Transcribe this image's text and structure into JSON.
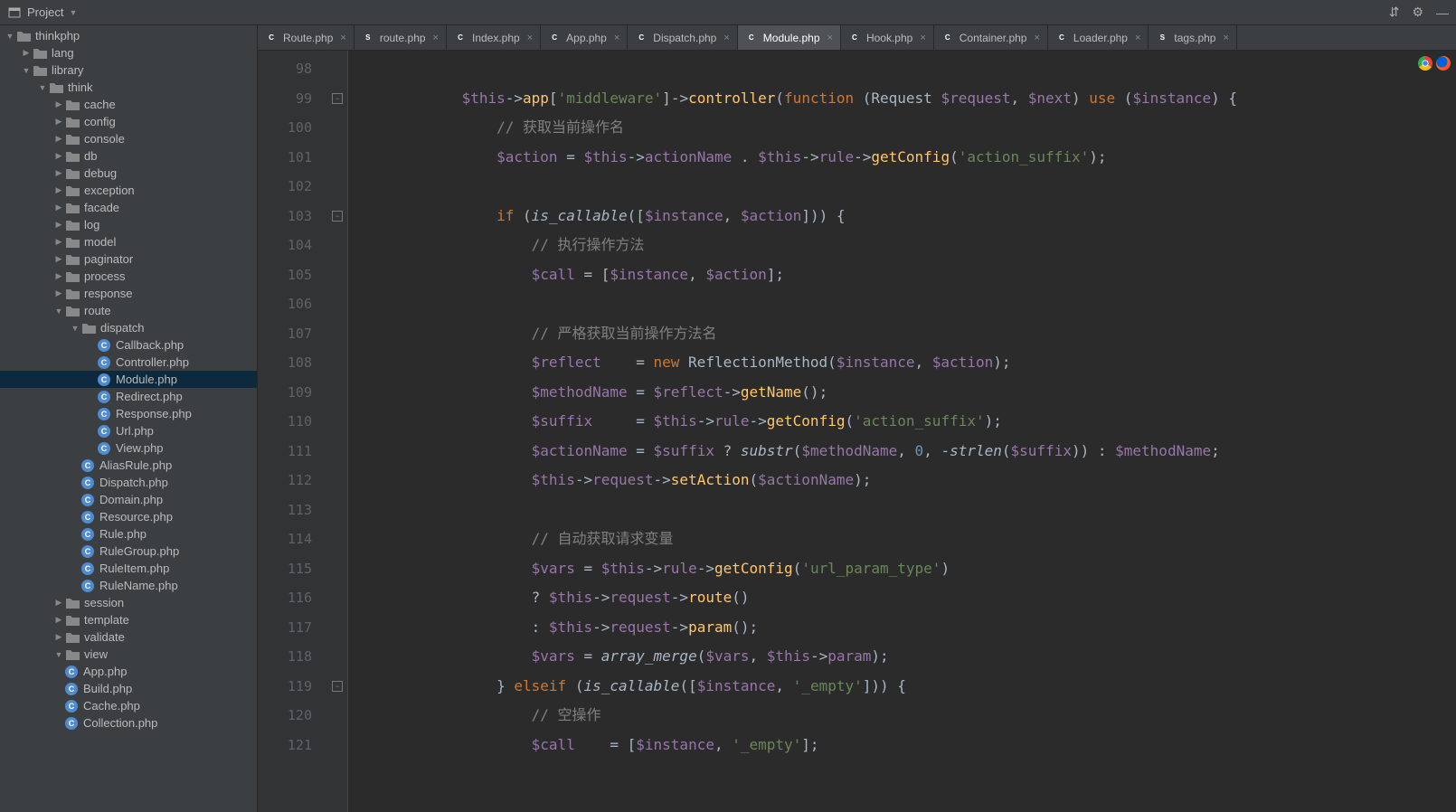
{
  "toolbar": {
    "title": "Project"
  },
  "tabs": [
    {
      "icon": "C",
      "cls": "php-c",
      "label": "Route.php"
    },
    {
      "icon": "S",
      "cls": "php-s",
      "label": "route.php"
    },
    {
      "icon": "C",
      "cls": "php-c",
      "label": "Index.php"
    },
    {
      "icon": "C",
      "cls": "php-c",
      "label": "App.php"
    },
    {
      "icon": "C",
      "cls": "php-c",
      "label": "Dispatch.php"
    },
    {
      "icon": "C",
      "cls": "php-c",
      "label": "Module.php",
      "active": true
    },
    {
      "icon": "C",
      "cls": "php-c",
      "label": "Hook.php"
    },
    {
      "icon": "C",
      "cls": "php-c",
      "label": "Container.php"
    },
    {
      "icon": "C",
      "cls": "php-c",
      "label": "Loader.php"
    },
    {
      "icon": "S",
      "cls": "php-s",
      "label": "tags.php"
    }
  ],
  "tree": [
    {
      "d": 0,
      "a": "open",
      "t": "fld",
      "l": "thinkphp"
    },
    {
      "d": 1,
      "a": "closed",
      "t": "fld",
      "l": "lang"
    },
    {
      "d": 1,
      "a": "open",
      "t": "fld",
      "l": "library"
    },
    {
      "d": 2,
      "a": "open",
      "t": "fld",
      "l": "think"
    },
    {
      "d": 3,
      "a": "closed",
      "t": "fld",
      "l": "cache"
    },
    {
      "d": 3,
      "a": "closed",
      "t": "fld",
      "l": "config"
    },
    {
      "d": 3,
      "a": "closed",
      "t": "fld",
      "l": "console"
    },
    {
      "d": 3,
      "a": "closed",
      "t": "fld",
      "l": "db"
    },
    {
      "d": 3,
      "a": "closed",
      "t": "fld",
      "l": "debug"
    },
    {
      "d": 3,
      "a": "closed",
      "t": "fld",
      "l": "exception"
    },
    {
      "d": 3,
      "a": "closed",
      "t": "fld",
      "l": "facade"
    },
    {
      "d": 3,
      "a": "closed",
      "t": "fld",
      "l": "log"
    },
    {
      "d": 3,
      "a": "closed",
      "t": "fld",
      "l": "model"
    },
    {
      "d": 3,
      "a": "closed",
      "t": "fld",
      "l": "paginator"
    },
    {
      "d": 3,
      "a": "closed",
      "t": "fld",
      "l": "process"
    },
    {
      "d": 3,
      "a": "closed",
      "t": "fld",
      "l": "response"
    },
    {
      "d": 3,
      "a": "open",
      "t": "fld",
      "l": "route"
    },
    {
      "d": 4,
      "a": "open",
      "t": "fld",
      "l": "dispatch"
    },
    {
      "d": 5,
      "a": "none",
      "t": "php-c",
      "l": "Callback.php"
    },
    {
      "d": 5,
      "a": "none",
      "t": "php-c",
      "l": "Controller.php"
    },
    {
      "d": 5,
      "a": "none",
      "t": "php-c",
      "l": "Module.php",
      "sel": true
    },
    {
      "d": 5,
      "a": "none",
      "t": "php-c",
      "l": "Redirect.php"
    },
    {
      "d": 5,
      "a": "none",
      "t": "php-c",
      "l": "Response.php"
    },
    {
      "d": 5,
      "a": "none",
      "t": "php-c",
      "l": "Url.php"
    },
    {
      "d": 5,
      "a": "none",
      "t": "php-c",
      "l": "View.php"
    },
    {
      "d": 4,
      "a": "none",
      "t": "php-c",
      "l": "AliasRule.php"
    },
    {
      "d": 4,
      "a": "none",
      "t": "php-c",
      "l": "Dispatch.php"
    },
    {
      "d": 4,
      "a": "none",
      "t": "php-c",
      "l": "Domain.php"
    },
    {
      "d": 4,
      "a": "none",
      "t": "php-c",
      "l": "Resource.php"
    },
    {
      "d": 4,
      "a": "none",
      "t": "php-c",
      "l": "Rule.php"
    },
    {
      "d": 4,
      "a": "none",
      "t": "php-c",
      "l": "RuleGroup.php"
    },
    {
      "d": 4,
      "a": "none",
      "t": "php-c",
      "l": "RuleItem.php"
    },
    {
      "d": 4,
      "a": "none",
      "t": "php-c",
      "l": "RuleName.php"
    },
    {
      "d": 3,
      "a": "closed",
      "t": "fld",
      "l": "session"
    },
    {
      "d": 3,
      "a": "closed",
      "t": "fld",
      "l": "template"
    },
    {
      "d": 3,
      "a": "closed",
      "t": "fld",
      "l": "validate"
    },
    {
      "d": 3,
      "a": "open",
      "t": "fld",
      "l": "view"
    },
    {
      "d": 3,
      "a": "none",
      "t": "php-c",
      "l": "App.php"
    },
    {
      "d": 3,
      "a": "none",
      "t": "php-c",
      "l": "Build.php"
    },
    {
      "d": 3,
      "a": "none",
      "t": "php-c",
      "l": "Cache.php"
    },
    {
      "d": 3,
      "a": "none",
      "t": "php-c",
      "l": "Collection.php"
    }
  ],
  "code": {
    "start": 98,
    "folds": [
      99,
      103,
      119
    ],
    "lines": [
      "",
      "            <span class='c-var'>$this</span><span class='c-arrow'>-&gt;</span><span class='c-fn'>app</span>[<span class='c-str'>'middleware'</span>]<span class='c-arrow'>-&gt;</span><span class='c-fn'>controller</span>(<span class='c-kw'>function </span>(Request <span class='c-var'>$request</span>, <span class='c-var'>$next</span>) <span class='c-kw'>use </span>(<span class='c-var'>$instance</span>) {",
      "                <span class='c-cm'>// 获取当前操作名</span>",
      "                <span class='c-var'>$action</span> = <span class='c-var'>$this</span><span class='c-arrow'>-&gt;</span><span class='c-var'>actionName</span> . <span class='c-var'>$this</span><span class='c-arrow'>-&gt;</span><span class='c-var'>rule</span><span class='c-arrow'>-&gt;</span><span class='c-fn'>getConfig</span>(<span class='c-str'>'action_suffix'</span>);",
      "",
      "                <span class='c-kw'>if </span>(<span class='c-it'>is_callable</span>([<span class='c-var'>$instance</span>, <span class='c-var'>$action</span>])) {",
      "                    <span class='c-cm'>// 执行操作方法</span>",
      "                    <span class='c-var'>$call</span> = [<span class='c-var'>$instance</span>, <span class='c-var'>$action</span>];",
      "",
      "                    <span class='c-cm'>// 严格获取当前操作方法名</span>",
      "                    <span class='c-var'>$reflect</span>    = <span class='c-kw'>new </span>ReflectionMethod(<span class='c-var'>$instance</span>, <span class='c-var'>$action</span>);",
      "                    <span class='c-var'>$methodName</span> = <span class='c-var'>$reflect</span><span class='c-arrow'>-&gt;</span><span class='c-fn'>getName</span>();",
      "                    <span class='c-var'>$suffix</span>     = <span class='c-var'>$this</span><span class='c-arrow'>-&gt;</span><span class='c-var'>rule</span><span class='c-arrow'>-&gt;</span><span class='c-fn'>getConfig</span>(<span class='c-str'>'action_suffix'</span>);",
      "                    <span class='c-var'>$actionName</span> = <span class='c-var'>$suffix</span> ? <span class='c-it'>substr</span>(<span class='c-var'>$methodName</span>, <span class='c-num'>0</span>, -<span class='c-it'>strlen</span>(<span class='c-var'>$suffix</span>)) : <span class='c-var'>$methodName</span>;",
      "                    <span class='c-var'>$this</span><span class='c-arrow'>-&gt;</span><span class='c-var'>request</span><span class='c-arrow'>-&gt;</span><span class='c-fn'>setAction</span>(<span class='c-var'>$actionName</span>);",
      "",
      "                    <span class='c-cm'>// 自动获取请求变量</span>",
      "                    <span class='c-var'>$vars</span> = <span class='c-var'>$this</span><span class='c-arrow'>-&gt;</span><span class='c-var'>rule</span><span class='c-arrow'>-&gt;</span><span class='c-fn'>getConfig</span>(<span class='c-str'>'url_param_type'</span>)",
      "                    ? <span class='c-var'>$this</span><span class='c-arrow'>-&gt;</span><span class='c-var'>request</span><span class='c-arrow'>-&gt;</span><span class='c-fn'>route</span>()",
      "                    : <span class='c-var'>$this</span><span class='c-arrow'>-&gt;</span><span class='c-var'>request</span><span class='c-arrow'>-&gt;</span><span class='c-fn'>param</span>();",
      "                    <span class='c-var'>$vars</span> = <span class='c-it'>array_merge</span>(<span class='c-var'>$vars</span>, <span class='c-var'>$this</span><span class='c-arrow'>-&gt;</span><span class='c-var'>param</span>);",
      "                } <span class='c-kw'>elseif </span>(<span class='c-it'>is_callable</span>([<span class='c-var'>$instance</span>, <span class='c-str'>'_empty'</span>])) {",
      "                    <span class='c-cm'>// 空操作</span>",
      "                    <span class='c-var'>$call</span>    = [<span class='c-var'>$instance</span>, <span class='c-str'>'_empty'</span>];"
    ]
  }
}
